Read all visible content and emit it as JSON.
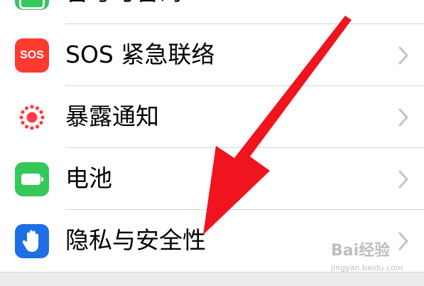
{
  "settings": {
    "items": [
      {
        "label": "番号与番码",
        "icon": "green-partial-icon"
      },
      {
        "label": "SOS 紧急联络",
        "icon": "sos-icon",
        "icon_text": "SOS"
      },
      {
        "label": "暴露通知",
        "icon": "exposure-notification-icon"
      },
      {
        "label": "电池",
        "icon": "battery-icon"
      },
      {
        "label": "隐私与安全性",
        "icon": "privacy-hand-icon"
      }
    ]
  },
  "watermark": {
    "brand": "Bai经验",
    "sub": "jingyan.baidu.com"
  },
  "colors": {
    "sos_red": "#ff3b30",
    "exposure_red": "#ff3b47",
    "battery_green": "#34c759",
    "privacy_blue": "#1e6fe6",
    "arrow_red": "#f0141e"
  }
}
